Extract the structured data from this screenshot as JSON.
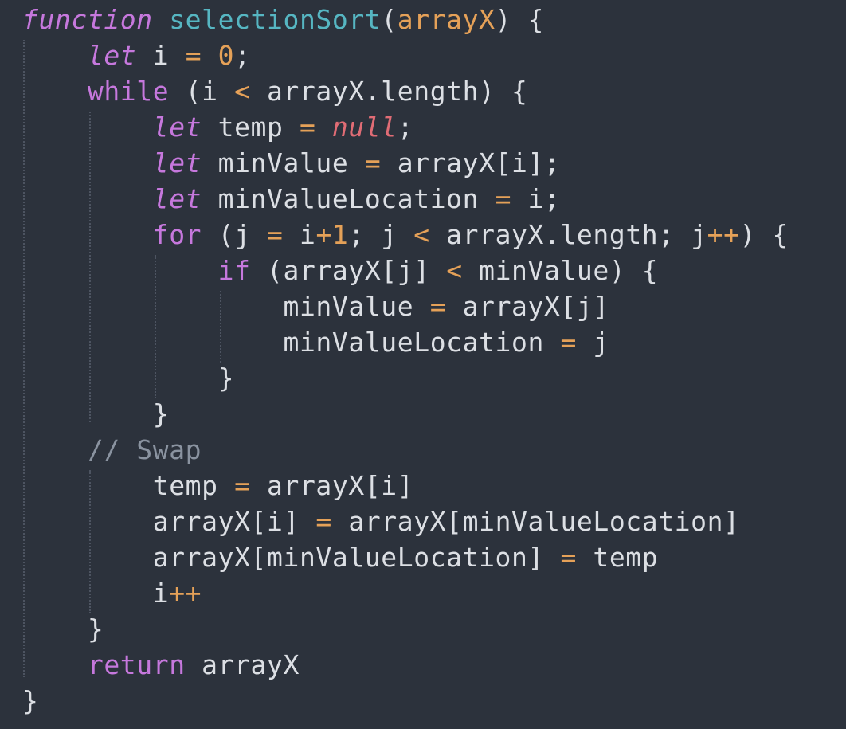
{
  "editor": {
    "theme_colors": {
      "background": "#2c323c",
      "keyword": "#c678dd",
      "function_name": "#56b6c2",
      "parameter": "#e5a158",
      "number": "#e5a158",
      "operator": "#e5a158",
      "null": "#e06c75",
      "comment": "#8a93a0",
      "text": "#dcdfe4"
    },
    "lines": [
      [
        {
          "t": "function",
          "c": "kw-it"
        },
        {
          "t": " ",
          "c": "plain"
        },
        {
          "t": "selectionSort",
          "c": "fn"
        },
        {
          "t": "(",
          "c": "punc"
        },
        {
          "t": "arrayX",
          "c": "param"
        },
        {
          "t": ") {",
          "c": "punc"
        }
      ],
      [
        {
          "t": "    ",
          "c": "plain"
        },
        {
          "t": "let",
          "c": "kw-it"
        },
        {
          "t": " i ",
          "c": "plain"
        },
        {
          "t": "=",
          "c": "op"
        },
        {
          "t": " ",
          "c": "plain"
        },
        {
          "t": "0",
          "c": "num"
        },
        {
          "t": ";",
          "c": "punc"
        }
      ],
      [
        {
          "t": "    ",
          "c": "plain"
        },
        {
          "t": "while",
          "c": "kw"
        },
        {
          "t": " (i ",
          "c": "plain"
        },
        {
          "t": "<",
          "c": "op"
        },
        {
          "t": " arrayX.length) {",
          "c": "plain"
        }
      ],
      [
        {
          "t": "        ",
          "c": "plain"
        },
        {
          "t": "let",
          "c": "kw-it"
        },
        {
          "t": " temp ",
          "c": "plain"
        },
        {
          "t": "=",
          "c": "op"
        },
        {
          "t": " ",
          "c": "plain"
        },
        {
          "t": "null",
          "c": "null"
        },
        {
          "t": ";",
          "c": "punc"
        }
      ],
      [
        {
          "t": "        ",
          "c": "plain"
        },
        {
          "t": "let",
          "c": "kw-it"
        },
        {
          "t": " minValue ",
          "c": "plain"
        },
        {
          "t": "=",
          "c": "op"
        },
        {
          "t": " arrayX[i];",
          "c": "plain"
        }
      ],
      [
        {
          "t": "        ",
          "c": "plain"
        },
        {
          "t": "let",
          "c": "kw-it"
        },
        {
          "t": " minValueLocation ",
          "c": "plain"
        },
        {
          "t": "=",
          "c": "op"
        },
        {
          "t": " i;",
          "c": "plain"
        }
      ],
      [
        {
          "t": "        ",
          "c": "plain"
        },
        {
          "t": "for",
          "c": "kw"
        },
        {
          "t": " (j ",
          "c": "plain"
        },
        {
          "t": "=",
          "c": "op"
        },
        {
          "t": " i",
          "c": "plain"
        },
        {
          "t": "+",
          "c": "op"
        },
        {
          "t": "1",
          "c": "num"
        },
        {
          "t": "; j ",
          "c": "plain"
        },
        {
          "t": "<",
          "c": "op"
        },
        {
          "t": " arrayX.length; j",
          "c": "plain"
        },
        {
          "t": "++",
          "c": "op"
        },
        {
          "t": ") {",
          "c": "plain"
        }
      ],
      [
        {
          "t": "            ",
          "c": "plain"
        },
        {
          "t": "if",
          "c": "kw"
        },
        {
          "t": " (arrayX[j] ",
          "c": "plain"
        },
        {
          "t": "<",
          "c": "op"
        },
        {
          "t": " minValue) {",
          "c": "plain"
        }
      ],
      [
        {
          "t": "                minValue ",
          "c": "plain"
        },
        {
          "t": "=",
          "c": "op"
        },
        {
          "t": " arrayX[j]",
          "c": "plain"
        }
      ],
      [
        {
          "t": "                minValueLocation ",
          "c": "plain"
        },
        {
          "t": "=",
          "c": "op"
        },
        {
          "t": " j",
          "c": "plain"
        }
      ],
      [
        {
          "t": "            }",
          "c": "plain"
        }
      ],
      [
        {
          "t": "        }",
          "c": "plain"
        }
      ],
      [
        {
          "t": "    ",
          "c": "plain"
        },
        {
          "t": "// Swap",
          "c": "cmt"
        }
      ],
      [
        {
          "t": "        temp ",
          "c": "plain"
        },
        {
          "t": "=",
          "c": "op"
        },
        {
          "t": " arrayX[i]",
          "c": "plain"
        }
      ],
      [
        {
          "t": "        arrayX[i] ",
          "c": "plain"
        },
        {
          "t": "=",
          "c": "op"
        },
        {
          "t": " arrayX[minValueLocation]",
          "c": "plain"
        }
      ],
      [
        {
          "t": "        arrayX[minValueLocation] ",
          "c": "plain"
        },
        {
          "t": "=",
          "c": "op"
        },
        {
          "t": " temp",
          "c": "plain"
        }
      ],
      [
        {
          "t": "        i",
          "c": "plain"
        },
        {
          "t": "++",
          "c": "op"
        }
      ],
      [
        {
          "t": "    }",
          "c": "plain"
        }
      ],
      [
        {
          "t": "    ",
          "c": "plain"
        },
        {
          "t": "return",
          "c": "kw"
        },
        {
          "t": " arrayX",
          "c": "plain"
        }
      ],
      [
        {
          "t": "}",
          "c": "plain"
        }
      ]
    ]
  }
}
